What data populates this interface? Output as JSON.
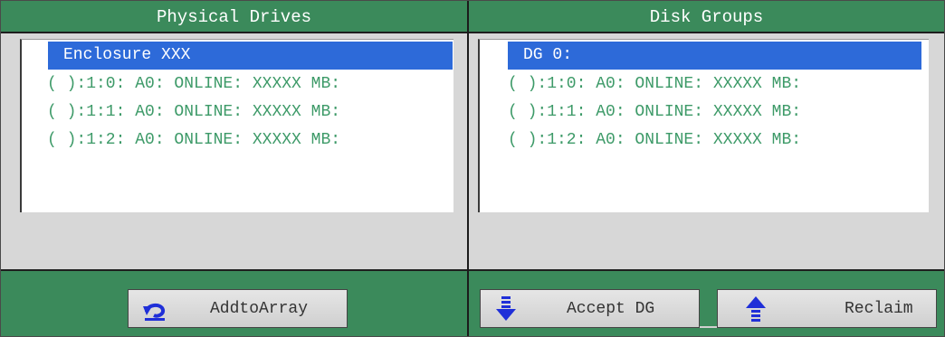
{
  "physical_drives": {
    "title": "Physical Drives",
    "items": [
      {
        "label": "Enclosure XXX",
        "selected": true
      },
      {
        "label": "( ):1:0: A0: ONLINE: XXXXX MB:",
        "selected": false
      },
      {
        "label": "( ):1:1: A0: ONLINE: XXXXX MB:",
        "selected": false
      },
      {
        "label": "( ):1:2: A0: ONLINE: XXXXX MB:",
        "selected": false
      }
    ],
    "add_button_label": "AddtoArray",
    "add_button_icon": "undo-arrow-icon"
  },
  "disk_groups": {
    "title": "Disk Groups",
    "items": [
      {
        "label": "DG 0:",
        "selected": true
      },
      {
        "label": "( ):1:0: A0: ONLINE: XXXXX MB:",
        "selected": false
      },
      {
        "label": "( ):1:1: A0: ONLINE: XXXXX MB:",
        "selected": false
      },
      {
        "label": "( ):1:2: A0: ONLINE: XXXXX MB:",
        "selected": false
      }
    ],
    "accept_button_label": "Accept DG",
    "accept_button_icon": "arrow-down-icon",
    "reclaim_button_label": "Reclaim",
    "reclaim_button_icon": "arrow-up-icon"
  },
  "colors": {
    "header_green": "#3b8a5b",
    "selection_blue": "#2d6ad9",
    "item_text_green": "#3d9a68",
    "icon_blue": "#1f2fd8",
    "panel_gray": "#d7d7d7"
  }
}
